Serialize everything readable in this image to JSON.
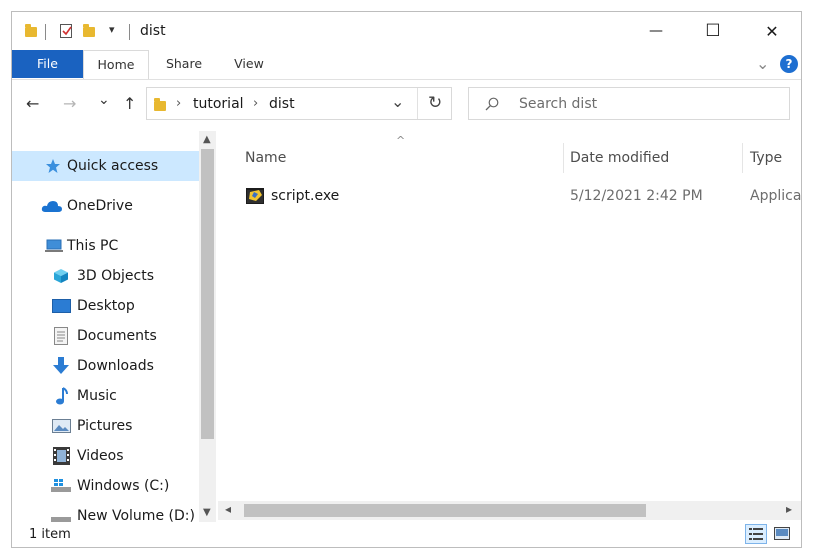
{
  "window": {
    "title": "dist",
    "qat_dropdown": "▾",
    "minimize": "—",
    "maximize": "☐",
    "close": "✕"
  },
  "ribbon": {
    "tabs": [
      "File",
      "Home",
      "Share",
      "View"
    ],
    "expand_chevron": "⌄",
    "help": "?"
  },
  "nav": {
    "back": "←",
    "forward": "→",
    "recent": "⌄",
    "up": "↑",
    "breadcrumb": [
      "tutorial",
      "dist"
    ],
    "crumb_sep": "›",
    "address_dropdown": "⌄",
    "refresh": "↻",
    "search_placeholder": "Search dist"
  },
  "navpane": {
    "quick_access": "Quick access",
    "onedrive": "OneDrive",
    "this_pc": "This PC",
    "items": [
      "3D Objects",
      "Desktop",
      "Documents",
      "Downloads",
      "Music",
      "Pictures",
      "Videos",
      "Windows (C:)",
      "New Volume (D:)"
    ]
  },
  "content": {
    "sort_indicator": "^",
    "columns": [
      "Name",
      "Date modified",
      "Type"
    ],
    "files": [
      {
        "name": "script.exe",
        "date": "5/12/2021 2:42 PM",
        "type": "Applicat"
      }
    ]
  },
  "status": {
    "item_count": "1 item"
  },
  "icon_names": [
    "folder-icon",
    "checkmark-icon",
    "quick-access-star-icon",
    "onedrive-cloud-icon",
    "pc-icon",
    "3d-objects-icon",
    "desktop-icon",
    "documents-icon",
    "downloads-icon",
    "music-icon",
    "pictures-icon",
    "videos-icon",
    "drive-icon",
    "exe-icon",
    "search-icon",
    "details-view-icon",
    "large-icons-view-icon"
  ],
  "colors": {
    "file_tab": "#1a62c0",
    "selected_nav": "#cce8ff",
    "folder": "#e8b830",
    "help": "#1e6fd1"
  }
}
